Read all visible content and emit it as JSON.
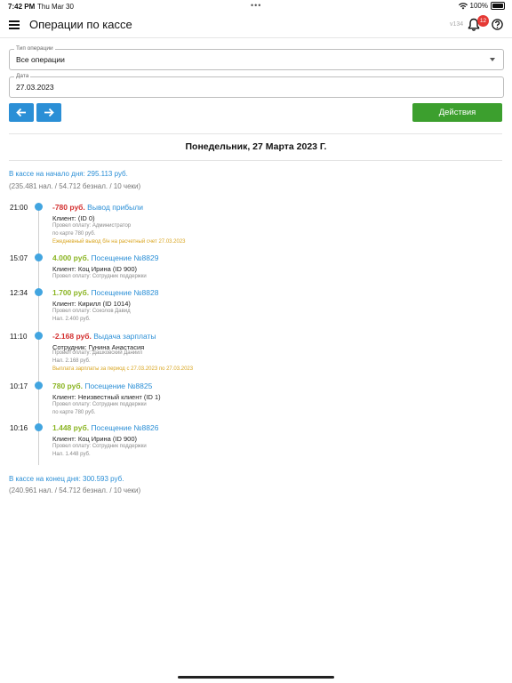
{
  "status": {
    "time": "7:42 PM",
    "date": "Thu Mar 30",
    "battery": "100%"
  },
  "header": {
    "title": "Операции по кассе",
    "version": "v134",
    "notifications": "12"
  },
  "filters": {
    "type_label": "Тип операции",
    "type_value": "Все операции",
    "date_label": "Дата",
    "date_value": "27.03.2023"
  },
  "toolbar": {
    "actions_label": "Действия"
  },
  "day": {
    "title": "Понедельник, 27 Марта 2023 Г.",
    "start_title": "В кассе на начало дня: 295.113 руб.",
    "start_sub": "(235.481 нал. / 54.712 безнал. / 10 чеки)",
    "end_title": "В кассе на конец дня: 300.593 руб.",
    "end_sub": "(240.961 нал. / 54.712 безнал. / 10 чеки)"
  },
  "operations": [
    {
      "time": "21:00",
      "amount": "-780 руб.",
      "title": "Вывод прибыли",
      "person": "Клиент: (ID 0)",
      "meta1": "Провел оплату: Администратор",
      "meta2": "по карте 780 руб.",
      "note": "Ежедневный вывод б/н на расчетный счет 27.03.2023"
    },
    {
      "time": "15:07",
      "amount": "4.000 руб.",
      "title": "Посещение №8829",
      "person": "Клиент: Коц Ирина (ID 900)",
      "meta1": "Провел оплату: Сотрудник поддержки"
    },
    {
      "time": "12:34",
      "amount": "1.700 руб.",
      "title": "Посещение №8828",
      "person": "Клиент: Кирилл (ID 1014)",
      "meta1": "Провел оплату: Соколов Давид",
      "meta2": "Нал. 2.400 руб."
    },
    {
      "time": "11:10",
      "amount": "-2.168 руб.",
      "title": "Выдача зарплаты",
      "person": "Сотрудник: Гунина Анастасия",
      "meta1": "Провел оплату: Дашковский Даниил",
      "meta2": "Нал. 2.168 руб.",
      "note": "Выплата зарплаты за период с 27.03.2023 по 27.03.2023"
    },
    {
      "time": "10:17",
      "amount": "780 руб.",
      "title": "Посещение №8825",
      "person": "Клиент: Неизвестный клиент (ID 1)",
      "meta1": "Провел оплату: Сотрудник поддержки",
      "meta2": "по карте 780 руб."
    },
    {
      "time": "10:16",
      "amount": "1.448 руб.",
      "title": "Посещение №8826",
      "person": "Клиент: Коц Ирина (ID 900)",
      "meta1": "Провел оплату: Сотрудник поддержки",
      "meta2": "Нал. 1.448 руб."
    }
  ],
  "colors": {
    "accent": "#2b8fd6",
    "action": "#3c9f2e",
    "negative": "#d32f2f",
    "positive": "#8bb524",
    "note": "#d9a520"
  }
}
